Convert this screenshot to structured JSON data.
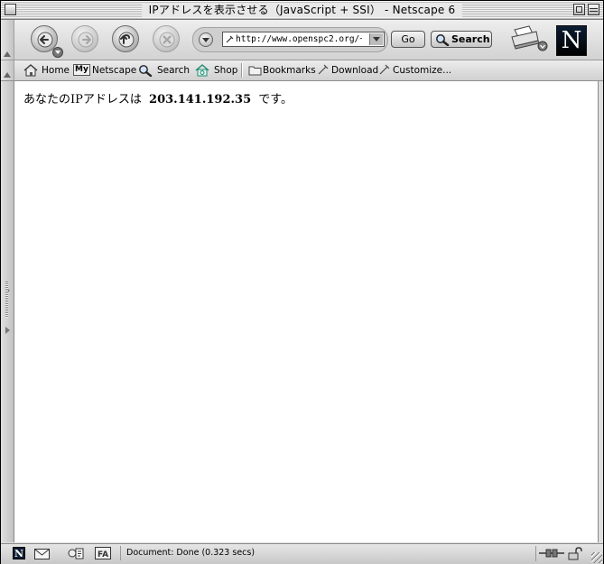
{
  "window": {
    "title": "IPアドレスを表示させる（JavaScript + SSI） - Netscape 6"
  },
  "navbar": {
    "url": "http://www.openspc2.org/~ope",
    "go_label": "Go",
    "search_label": "Search",
    "logo_letter": "N"
  },
  "personal_toolbar": {
    "home": "Home",
    "my_prefix": "My",
    "my_netscape": "Netscape",
    "search": "Search",
    "shop": "Shop",
    "bookmarks": "Bookmarks",
    "download": "Download",
    "customize": "Customize..."
  },
  "page": {
    "text_before": "あなたのIPアドレスは",
    "ip_address": "203.141.192.35",
    "text_after": "です。"
  },
  "statusbar": {
    "status_text": "Document: Done (0.323 secs)"
  }
}
